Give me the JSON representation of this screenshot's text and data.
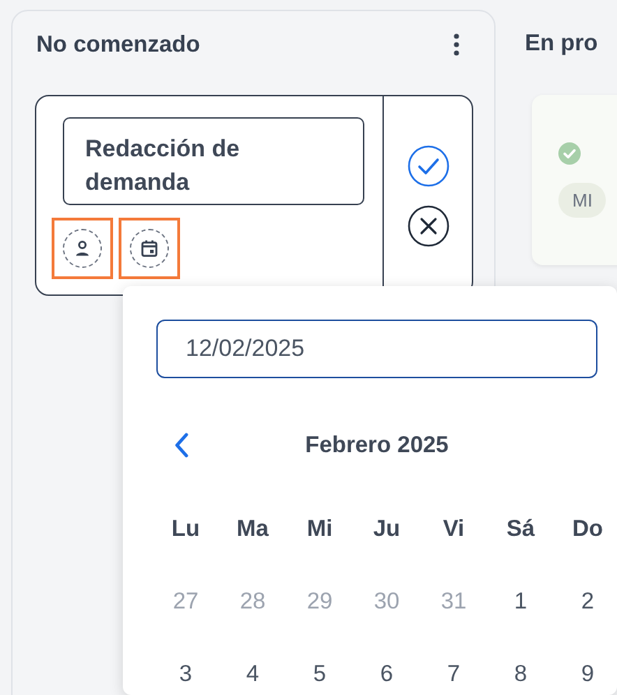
{
  "columns": [
    {
      "title": "No comenzado",
      "cards": [
        {
          "kind": "editing",
          "title_value": "Redacción de demanda",
          "assignee_highlighted": true,
          "date_highlighted": true
        }
      ]
    },
    {
      "title": "En pro",
      "cards": [
        {
          "kind": "task",
          "completed": true,
          "avatar": "MI"
        }
      ]
    }
  ],
  "datepicker": {
    "value": "12/02/2025",
    "month": "Febrero 2025",
    "weekdays": [
      "Lu",
      "Ma",
      "Mi",
      "Ju",
      "Vi",
      "Sá",
      "Do"
    ],
    "days": [
      {
        "label": "27",
        "outside": true
      },
      {
        "label": "28",
        "outside": true
      },
      {
        "label": "29",
        "outside": true
      },
      {
        "label": "30",
        "outside": true
      },
      {
        "label": "31",
        "outside": true
      },
      {
        "label": "1",
        "outside": false
      },
      {
        "label": "2",
        "outside": false
      },
      {
        "label": "3",
        "outside": false
      },
      {
        "label": "4",
        "outside": false
      },
      {
        "label": "5",
        "outside": false
      },
      {
        "label": "6",
        "outside": false
      },
      {
        "label": "7",
        "outside": false
      },
      {
        "label": "8",
        "outside": false
      },
      {
        "label": "9",
        "outside": false
      }
    ]
  }
}
